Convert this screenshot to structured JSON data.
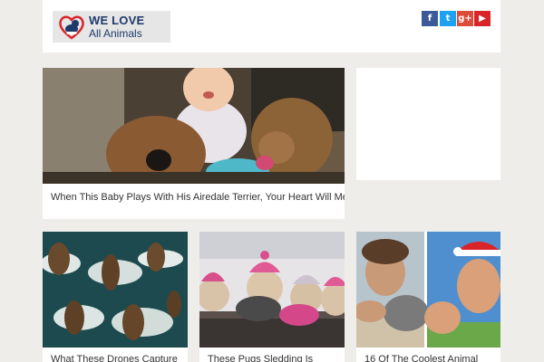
{
  "site": {
    "logo_line1": "WE LOVE",
    "logo_line2": "All Animals"
  },
  "social": [
    {
      "name": "facebook",
      "glyph": "f",
      "color": "#3b5998"
    },
    {
      "name": "twitter",
      "glyph": "t",
      "color": "#1da1f2"
    },
    {
      "name": "google-plus",
      "glyph": "g+",
      "color": "#dd4b39"
    },
    {
      "name": "youtube",
      "glyph": "▶",
      "color": "#d9252a"
    }
  ],
  "featured": {
    "title": "When This Baby Plays With His Airedale Terrier, Your Heart Will Melt"
  },
  "articles": [
    {
      "title": "What These Drones Capture"
    },
    {
      "title": "These Pugs Sledding Is"
    },
    {
      "title": "16 Of The Coolest Animal"
    }
  ]
}
